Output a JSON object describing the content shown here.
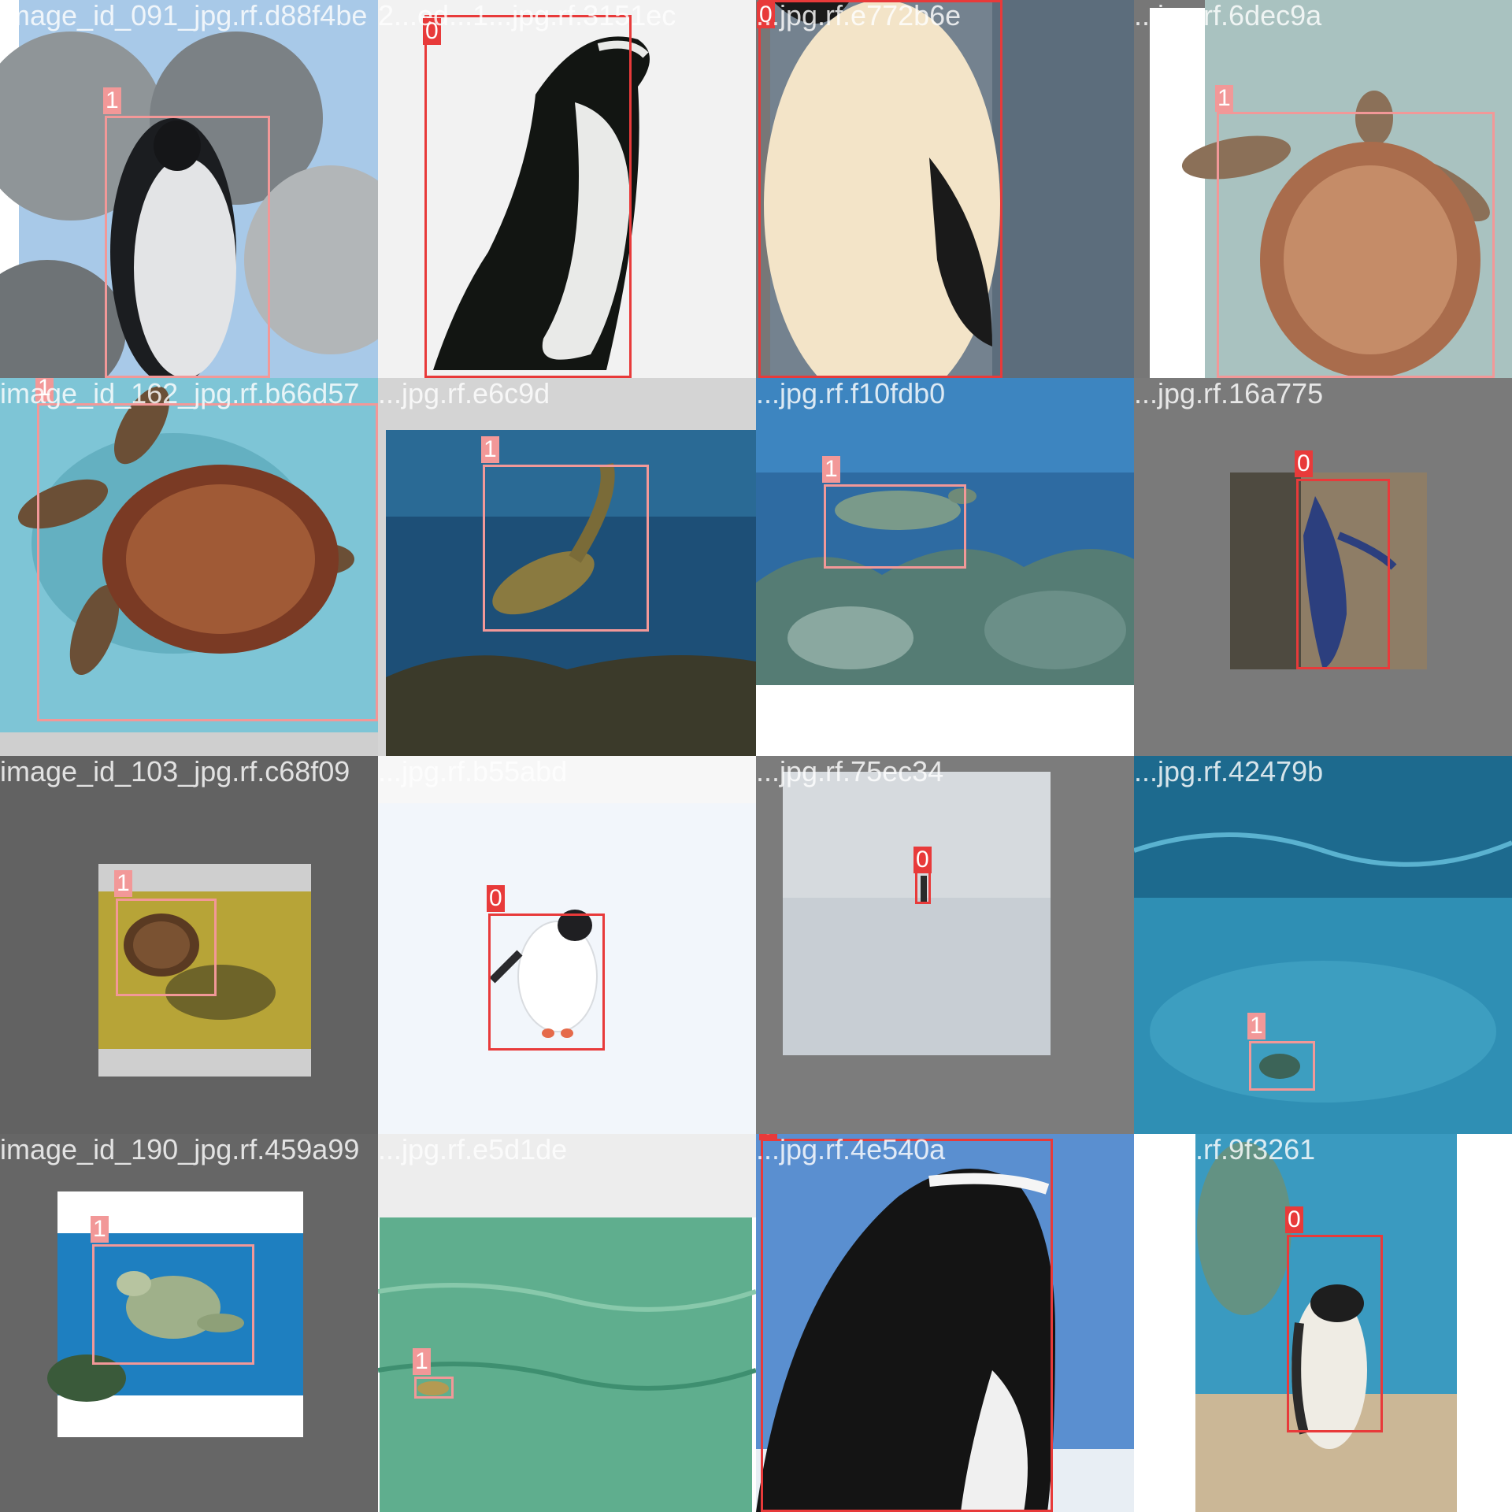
{
  "colors": {
    "class_0": "#e83a3a",
    "class_1": "#f29898",
    "filename_text": "#ffffff"
  },
  "tiles": [
    {
      "filename": "image_id_091_jpg.rf.d88f4be",
      "scene": "rockhopper-penguin-gray-rocks",
      "boxes": [
        {
          "label": "1",
          "class_id": 1
        }
      ]
    },
    {
      "filename": "2...ed...1...jpg.rf.3151ec",
      "scene": "magellanic-penguin-white-background",
      "boxes": [
        {
          "label": "0",
          "class_id": 0
        }
      ]
    },
    {
      "filename": "...jpg.rf.e772b6e",
      "scene": "penguin-closeup-belly",
      "boxes": [
        {
          "label": "0",
          "class_id": 0
        }
      ]
    },
    {
      "filename": "...jpg.rf.6dec9a",
      "scene": "sea-turtle-top-view-sand",
      "boxes": [
        {
          "label": "1",
          "class_id": 1
        }
      ]
    },
    {
      "filename": "image_id_162_jpg.rf.b66d57",
      "scene": "sea-turtle-turquoise-pool",
      "boxes": [
        {
          "label": "1",
          "class_id": 1
        }
      ]
    },
    {
      "filename": "...jpg.rf.e6c9d",
      "scene": "sea-turtle-deep-blue-ocean",
      "boxes": [
        {
          "label": "1",
          "class_id": 1
        }
      ]
    },
    {
      "filename": "...jpg.rf.f10fdb0",
      "scene": "sea-turtle-coral-reef",
      "boxes": [
        {
          "label": "1",
          "class_id": 1
        }
      ]
    },
    {
      "filename": "...jpg.rf.16a775",
      "scene": "blue-penguin-cliff",
      "boxes": [
        {
          "label": "0",
          "class_id": 0
        }
      ]
    },
    {
      "filename": "image_id_103_jpg.rf.c68f09",
      "scene": "turtle-yellow-sand-shadow",
      "boxes": [
        {
          "label": "1",
          "class_id": 1
        }
      ]
    },
    {
      "filename": "...jpg.rf.b55abd",
      "scene": "gentoo-penguin-snow",
      "boxes": [
        {
          "label": "0",
          "class_id": 0
        }
      ]
    },
    {
      "filename": "...jpg.rf.75ec34",
      "scene": "distant-penguin-snowfield",
      "boxes": [
        {
          "label": "0",
          "class_id": 0
        }
      ]
    },
    {
      "filename": "...jpg.rf.42479b",
      "scene": "small-turtle-underwater-surface",
      "boxes": [
        {
          "label": "1",
          "class_id": 1
        }
      ]
    },
    {
      "filename": "image_id_190_jpg.rf.459a99",
      "scene": "green-turtle-aquarium",
      "boxes": [
        {
          "label": "1",
          "class_id": 1
        }
      ]
    },
    {
      "filename": "...jpg.rf.e5d1de",
      "scene": "tiny-turtle-green-water",
      "boxes": [
        {
          "label": "1",
          "class_id": 1
        }
      ]
    },
    {
      "filename": "...jpg.rf.4e540a",
      "scene": "chinstrap-penguin-blue-sky",
      "boxes": [
        {
          "label": "0",
          "class_id": 0
        }
      ]
    },
    {
      "filename": "...jpg.rf.9f3261",
      "scene": "magellanic-penguin-beach",
      "boxes": [
        {
          "label": "0",
          "class_id": 0
        }
      ]
    }
  ]
}
